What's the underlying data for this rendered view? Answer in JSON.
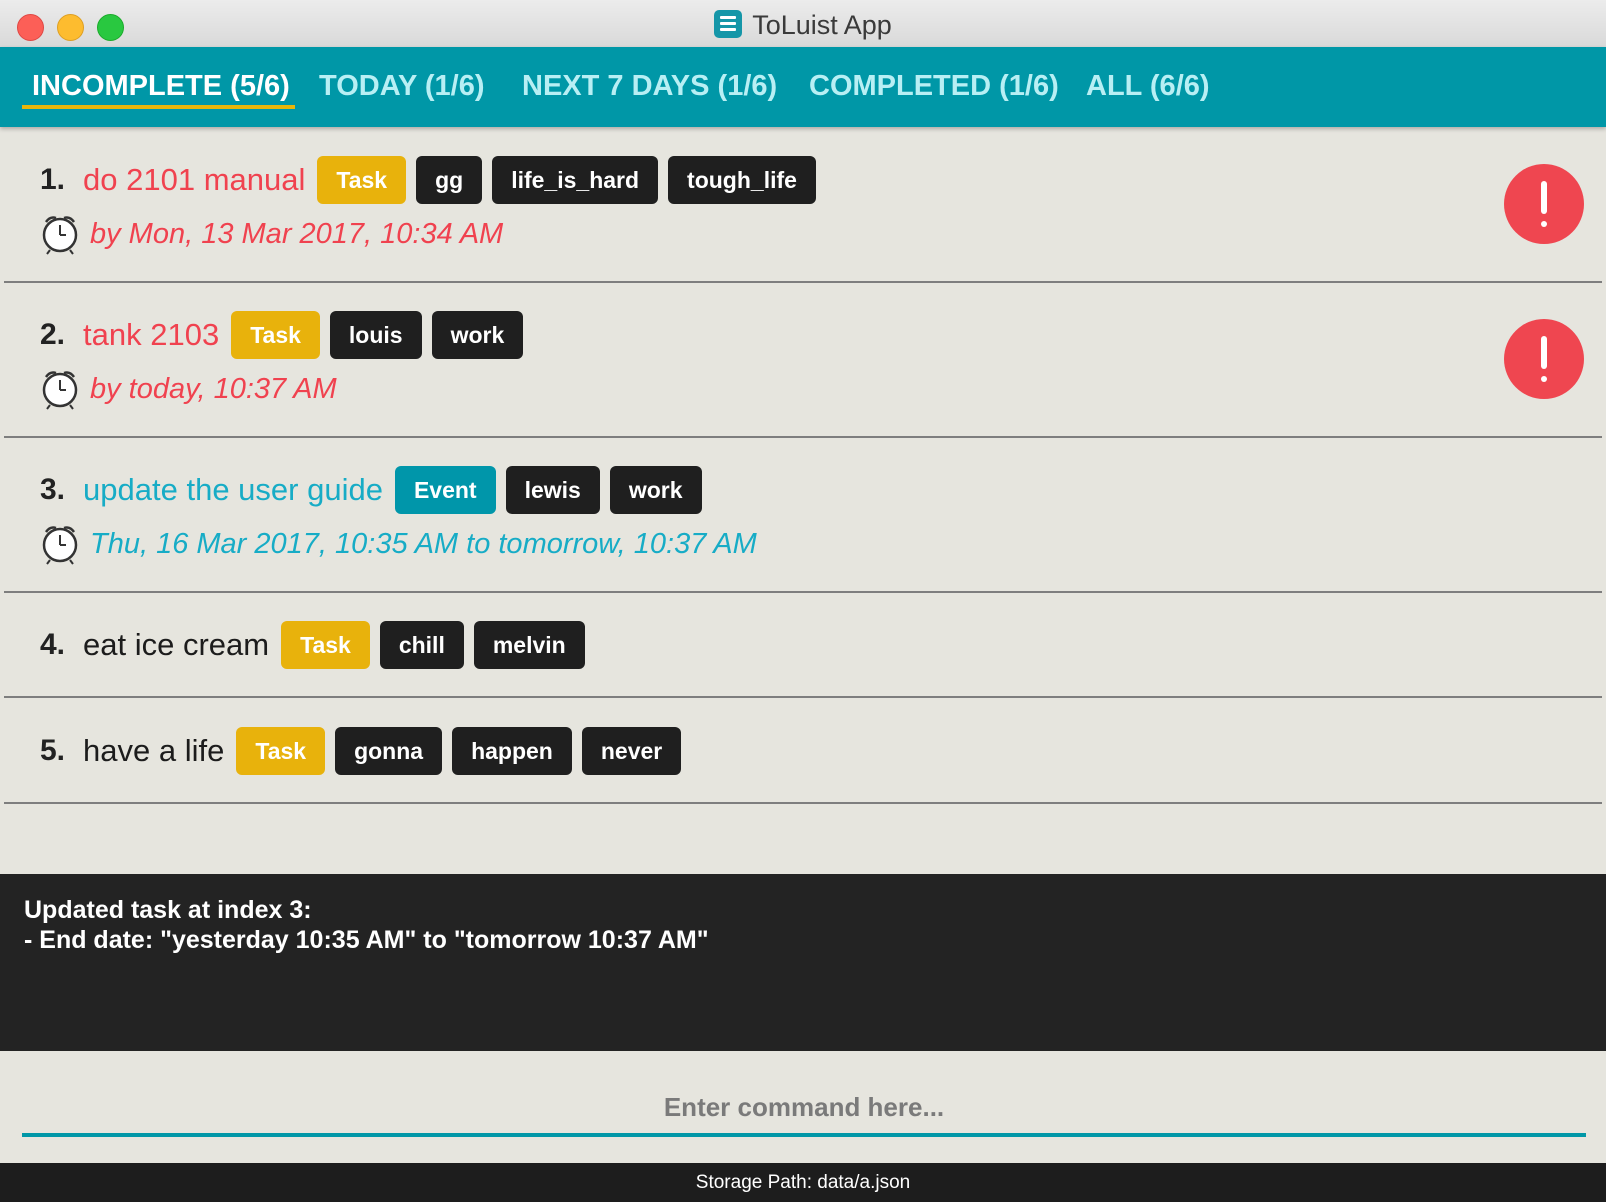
{
  "window": {
    "title": "ToLuist App"
  },
  "tabs": [
    {
      "label": "INCOMPLETE (5/6)",
      "active": true
    },
    {
      "label": "TODAY (1/6)"
    },
    {
      "label": "NEXT 7 DAYS (1/6)"
    },
    {
      "label": "COMPLETED (1/6)"
    },
    {
      "label": "ALL (6/6)"
    }
  ],
  "tasks": [
    {
      "index": "1.",
      "name": "do 2101 manual",
      "type": "Task",
      "tags": [
        "gg",
        "life_is_hard",
        "tough_life"
      ],
      "date": "by Mon, 13 Mar 2017, 10:34 AM",
      "overdue": true
    },
    {
      "index": "2.",
      "name": "tank 2103",
      "type": "Task",
      "tags": [
        "louis",
        "work"
      ],
      "date": "by today, 10:37 AM",
      "overdue": true
    },
    {
      "index": "3.",
      "name": "update the user guide",
      "type": "Event",
      "tags": [
        "lewis",
        "work"
      ],
      "date": "Thu, 16 Mar 2017, 10:35 AM to tomorrow, 10:37 AM"
    },
    {
      "index": "4.",
      "name": "eat ice cream",
      "type": "Task",
      "tags": [
        "chill",
        "melvin"
      ]
    },
    {
      "index": "5.",
      "name": "have a life",
      "type": "Task",
      "tags": [
        "gonna",
        "happen",
        "never"
      ]
    }
  ],
  "result": {
    "line1": "Updated task at index 3:",
    "line2": "- End date: \"yesterday 10:35 AM\" to \"tomorrow 10:37 AM\""
  },
  "command": {
    "placeholder": "Enter command here..."
  },
  "status": {
    "storage_path": "Storage Path: data/a.json"
  },
  "colors": {
    "accent": "#0097a7",
    "overdue": "#f0424f",
    "event": "#17acc6",
    "task_badge": "#e8b20c",
    "tag": "#1f1f1f"
  }
}
